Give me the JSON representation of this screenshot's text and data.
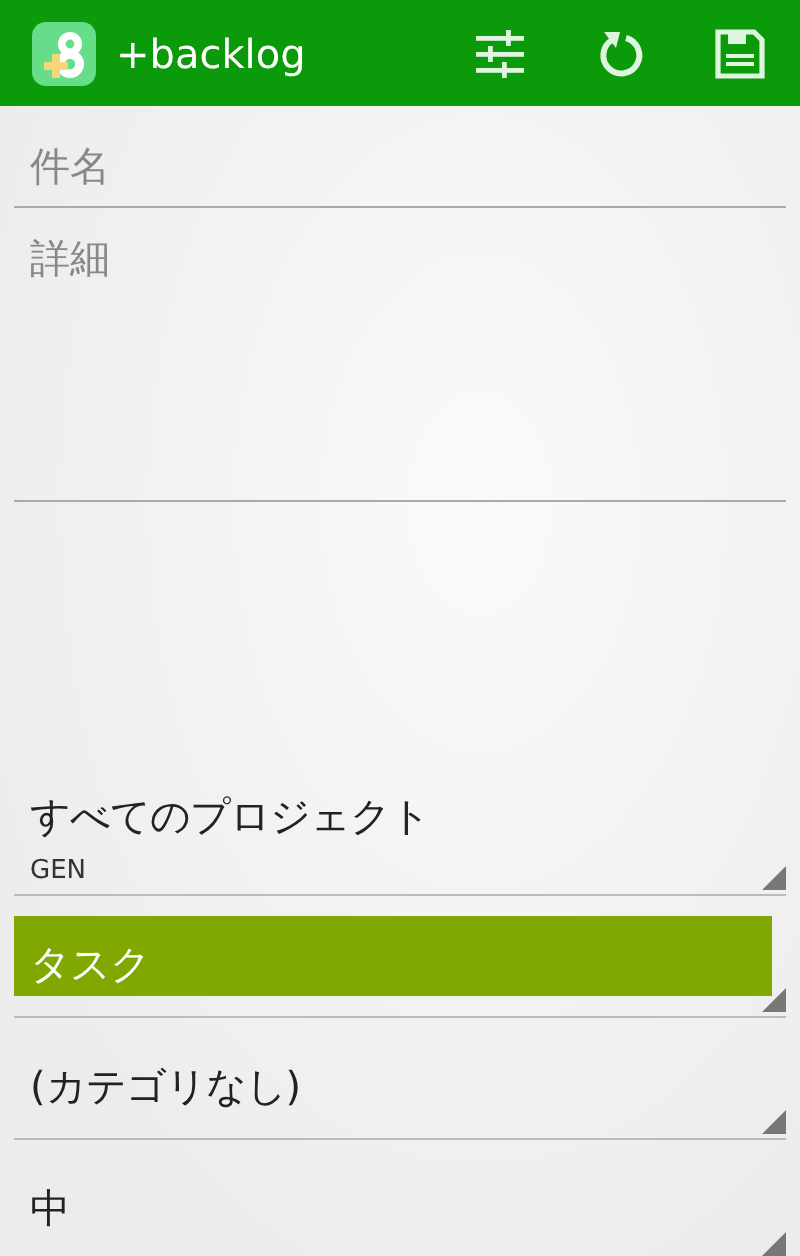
{
  "app_bar": {
    "title": "+backlog"
  },
  "form": {
    "subject": {
      "placeholder": "件名"
    },
    "details": {
      "placeholder": "詳細"
    }
  },
  "spinners": [
    {
      "value": "すべてのプロジェクト",
      "subtitle": "GEN",
      "highlighted": false
    },
    {
      "value": "タスク",
      "highlighted": true
    },
    {
      "value": "(カテゴリなし)",
      "highlighted": false
    },
    {
      "value": "中",
      "highlighted": false
    }
  ]
}
